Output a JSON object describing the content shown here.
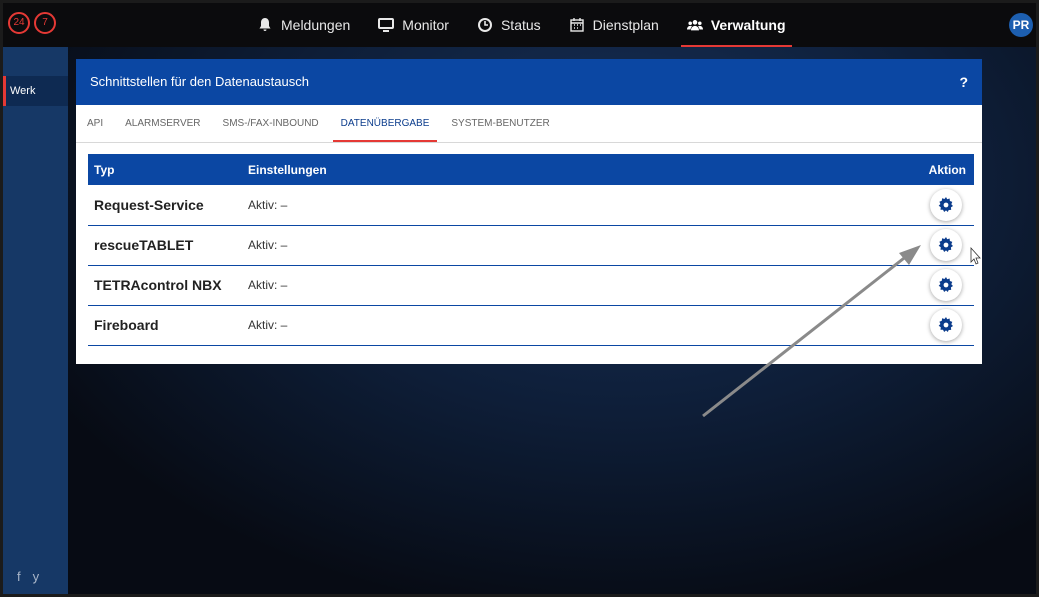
{
  "logo": {
    "left": "24",
    "right": "7"
  },
  "nav": {
    "items": [
      {
        "label": "Meldungen",
        "icon": "bell-icon"
      },
      {
        "label": "Monitor",
        "icon": "monitor-icon"
      },
      {
        "label": "Status",
        "icon": "clock-icon"
      },
      {
        "label": "Dienstplan",
        "icon": "calendar-icon"
      },
      {
        "label": "Verwaltung",
        "icon": "users-icon",
        "active": true
      }
    ],
    "accent": "#e53935"
  },
  "user": {
    "initials": "PR"
  },
  "sidebar": {
    "items": [
      {
        "label": "Werk",
        "active": true
      }
    ],
    "social": [
      "f",
      "y"
    ]
  },
  "panel": {
    "title": "Schnittstellen für den Datenaustausch",
    "help": "?",
    "tabs": [
      {
        "label": "API"
      },
      {
        "label": "ALARMSERVER"
      },
      {
        "label": "SMS-/FAX-INBOUND"
      },
      {
        "label": "DATENÜBERGABE",
        "active": true
      },
      {
        "label": "SYSTEM-BENUTZER"
      }
    ]
  },
  "table": {
    "headers": {
      "type": "Typ",
      "settings": "Einstellungen",
      "action": "Aktion"
    },
    "rows": [
      {
        "type": "Request-Service",
        "settings": "Aktiv: –"
      },
      {
        "type": "rescueTABLET",
        "settings": "Aktiv: –"
      },
      {
        "type": "TETRAcontrol NBX",
        "settings": "Aktiv: –"
      },
      {
        "type": "Fireboard",
        "settings": "Aktiv: –"
      }
    ]
  },
  "colors": {
    "brand": "#0b47a3",
    "accent": "#e53935"
  }
}
